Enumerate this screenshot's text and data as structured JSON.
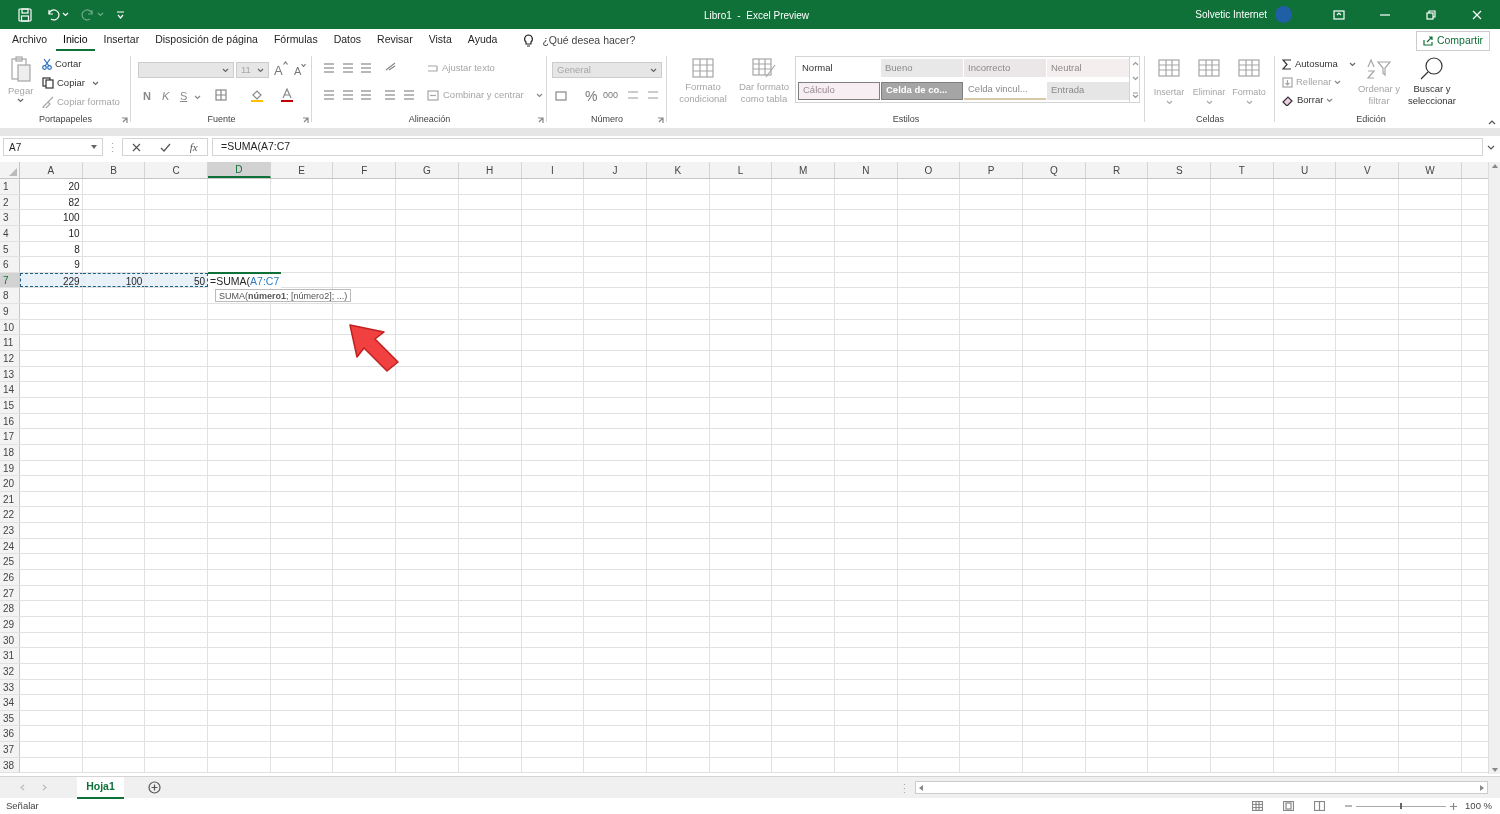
{
  "title_bar": {
    "title": "Libro1  -  Excel Preview",
    "user": "Solvetic Internet"
  },
  "menu_tabs": [
    {
      "label": "Archivo",
      "selected": false
    },
    {
      "label": "Inicio",
      "selected": true
    },
    {
      "label": "Insertar",
      "selected": false
    },
    {
      "label": "Disposición de página",
      "selected": false
    },
    {
      "label": "Fórmulas",
      "selected": false
    },
    {
      "label": "Datos",
      "selected": false
    },
    {
      "label": "Revisar",
      "selected": false
    },
    {
      "label": "Vista",
      "selected": false
    },
    {
      "label": "Ayuda",
      "selected": false
    }
  ],
  "search": {
    "placeholder": "¿Qué desea hacer?"
  },
  "share_button": "Compartir",
  "ribbon": {
    "clipboard": {
      "label": "Portapapeles",
      "paste": {
        "label": "Pegar",
        "disabled": true
      },
      "items": [
        {
          "label": "Cortar",
          "disabled": false
        },
        {
          "label": "Copiar",
          "disabled": false
        },
        {
          "label": "Copiar formato",
          "disabled": true
        }
      ]
    },
    "font": {
      "label": "Fuente",
      "size": "11",
      "grow": "A",
      "shrink": "A",
      "bold": "N",
      "italic": "K",
      "underline": "S"
    },
    "alignment": {
      "label": "Alineación",
      "wrap": "Ajustar texto",
      "merge": "Combinar y centrar"
    },
    "number": {
      "label": "Número",
      "format": "General",
      "percent": "%",
      "thousands": "000"
    },
    "styles": {
      "label": "Estilos",
      "conditional": "Formato condicional",
      "as_table": "Dar formato como tabla",
      "cells": [
        {
          "label": "Normal",
          "color": "#ffffff"
        },
        {
          "label": "Bueno",
          "color": "#e8e8e8"
        },
        {
          "label": "Incorrecto",
          "color": "#ebe6e8"
        },
        {
          "label": "Neutral",
          "color": "#f5eeee"
        },
        {
          "label": "Cálculo",
          "color": "#f7eef3"
        },
        {
          "label": "Celda de co...",
          "color": "#a5a5a5"
        },
        {
          "label": "Celda vincul...",
          "color": "#ffffff"
        },
        {
          "label": "Entrada",
          "color": "#e6e6e6"
        }
      ]
    },
    "cells_group": {
      "label": "Celdas",
      "items": [
        "Insertar",
        "Eliminar",
        "Formato"
      ]
    },
    "editing": {
      "label": "Edición",
      "items": [
        {
          "label": "Autosuma",
          "disabled": false
        },
        {
          "label": "Rellenar",
          "disabled": true
        },
        {
          "label": "Borrar",
          "disabled": false
        }
      ],
      "sort": "Ordenar y filtrar",
      "find": "Buscar y seleccionar"
    }
  },
  "formula_bar": {
    "name_box": "A7",
    "fx": "fx",
    "formula": "=SUMA(A7:C7"
  },
  "columns": [
    {
      "label": "A",
      "selected": false
    },
    {
      "label": "B",
      "selected": false
    },
    {
      "label": "C",
      "selected": false
    },
    {
      "label": "D",
      "selected": true
    },
    {
      "label": "E",
      "selected": false
    },
    {
      "label": "F",
      "selected": false
    },
    {
      "label": "G",
      "selected": false
    },
    {
      "label": "H",
      "selected": false
    },
    {
      "label": "I",
      "selected": false
    },
    {
      "label": "J",
      "selected": false
    },
    {
      "label": "K",
      "selected": false
    },
    {
      "label": "L",
      "selected": false
    },
    {
      "label": "M",
      "selected": false
    },
    {
      "label": "N",
      "selected": false
    },
    {
      "label": "O",
      "selected": false
    },
    {
      "label": "P",
      "selected": false
    },
    {
      "label": "Q",
      "selected": false
    },
    {
      "label": "R",
      "selected": false
    },
    {
      "label": "S",
      "selected": false
    },
    {
      "label": "T",
      "selected": false
    },
    {
      "label": "U",
      "selected": false
    },
    {
      "label": "V",
      "selected": false
    },
    {
      "label": "W",
      "selected": false
    }
  ],
  "rows": [
    {
      "label": "1",
      "selected": false,
      "cells": [
        "20"
      ]
    },
    {
      "label": "2",
      "selected": false,
      "cells": [
        "82"
      ]
    },
    {
      "label": "3",
      "selected": false,
      "cells": [
        "100"
      ]
    },
    {
      "label": "4",
      "selected": false,
      "cells": [
        "10"
      ]
    },
    {
      "label": "5",
      "selected": false,
      "cells": [
        "8"
      ]
    },
    {
      "label": "6",
      "selected": false,
      "cells": [
        "9"
      ]
    },
    {
      "label": "7",
      "selected": true,
      "highlighted": true,
      "cells": [
        "229",
        "100",
        "50"
      ],
      "editing": {
        "prefix": "=SUMA(",
        "reference": "A7:C7"
      }
    },
    {
      "label": "8",
      "selected": false
    },
    {
      "label": "9",
      "selected": false
    },
    {
      "label": "10",
      "selected": false
    },
    {
      "label": "11",
      "selected": false
    },
    {
      "label": "12",
      "selected": false
    },
    {
      "label": "13",
      "selected": false
    },
    {
      "label": "14",
      "selected": false
    },
    {
      "label": "15",
      "selected": false
    },
    {
      "label": "16",
      "selected": false
    },
    {
      "label": "17",
      "selected": false
    },
    {
      "label": "18",
      "selected": false
    },
    {
      "label": "19",
      "selected": false
    },
    {
      "label": "20",
      "selected": false
    },
    {
      "label": "21",
      "selected": false
    },
    {
      "label": "22",
      "selected": false
    },
    {
      "label": "23",
      "selected": false
    },
    {
      "label": "24",
      "selected": false
    },
    {
      "label": "25",
      "selected": false
    },
    {
      "label": "26",
      "selected": false
    },
    {
      "label": "27",
      "selected": false
    },
    {
      "label": "28",
      "selected": false
    },
    {
      "label": "29",
      "selected": false
    },
    {
      "label": "30",
      "selected": false
    },
    {
      "label": "31",
      "selected": false
    },
    {
      "label": "32",
      "selected": false
    },
    {
      "label": "33",
      "selected": false
    },
    {
      "label": "34",
      "selected": false
    },
    {
      "label": "35",
      "selected": false
    },
    {
      "label": "36",
      "selected": false
    },
    {
      "label": "37",
      "selected": false
    },
    {
      "label": "38",
      "selected": false
    }
  ],
  "tooltip": "SUMA(**número1**; [número2]; ...)",
  "sheet_tabs": [
    {
      "label": "Hoja1",
      "selected": true
    }
  ],
  "status_bar": {
    "mode": "Señalar",
    "zoom": "100 %",
    "zoom_slider": {
      "level": 0.5
    }
  }
}
